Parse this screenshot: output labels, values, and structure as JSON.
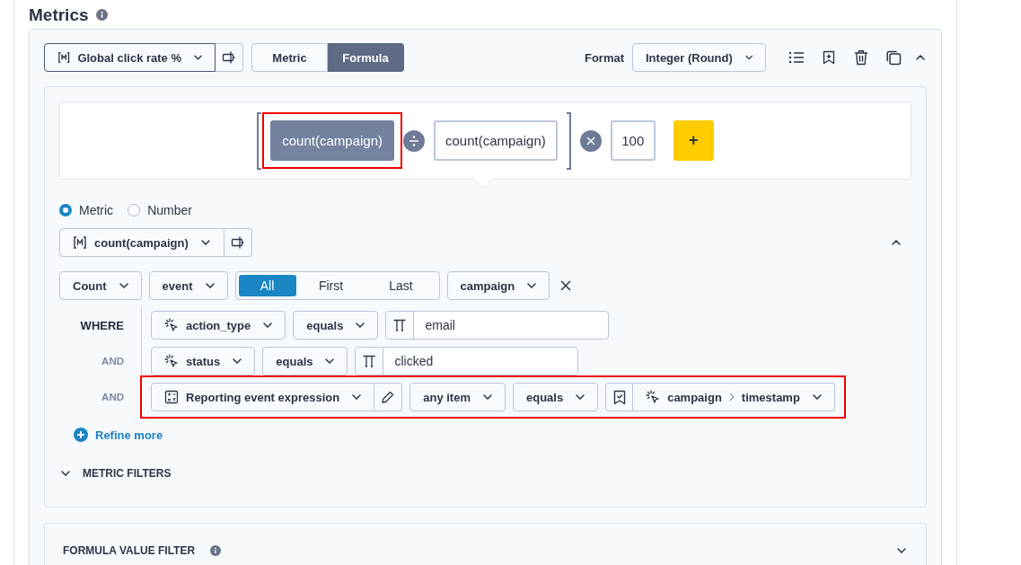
{
  "title": "Metrics",
  "metric": {
    "name": "Global click rate %",
    "expanded": true,
    "mode_tabs": [
      {
        "label": "Metric",
        "selected": false
      },
      {
        "label": "Formula",
        "selected": true
      }
    ],
    "format_label": "Format",
    "format": "Integer (Round)"
  },
  "formula": {
    "terms": [
      {
        "label": "count(campaign)",
        "selected": true,
        "highlighted": true
      },
      {
        "label": "count(campaign)",
        "selected": false,
        "highlighted": false
      }
    ],
    "multiplier": "100",
    "add_button": "+"
  },
  "operand_type": [
    {
      "label": "Metric",
      "selected": true
    },
    {
      "label": "Number",
      "selected": false
    }
  ],
  "operand": {
    "metric": "count(campaign)",
    "expanded": true,
    "aggregation": "Count",
    "source": "event",
    "occurrence": [
      {
        "label": "All",
        "selected": true
      },
      {
        "label": "First",
        "selected": false
      },
      {
        "label": "Last",
        "selected": false
      }
    ],
    "property": "campaign"
  },
  "conditions": [
    {
      "kind": "simple",
      "connector": "WHERE",
      "highlighted": false,
      "field": "action_type",
      "operator": "equals",
      "value": "email"
    },
    {
      "kind": "simple",
      "connector": "AND",
      "highlighted": false,
      "field": "status",
      "operator": "equals",
      "value": "clicked"
    },
    {
      "kind": "expression",
      "connector": "AND",
      "highlighted": true,
      "field": "Reporting event expression",
      "quantifier": "any item",
      "operator": "equals",
      "path": [
        "campaign",
        "timestamp"
      ]
    }
  ],
  "refine_more": "Refine more",
  "metric_filters": {
    "label": "METRIC FILTERS",
    "expanded": false
  },
  "formula_value_filter": {
    "label": "FORMULA VALUE FILTER",
    "expanded": false
  }
}
